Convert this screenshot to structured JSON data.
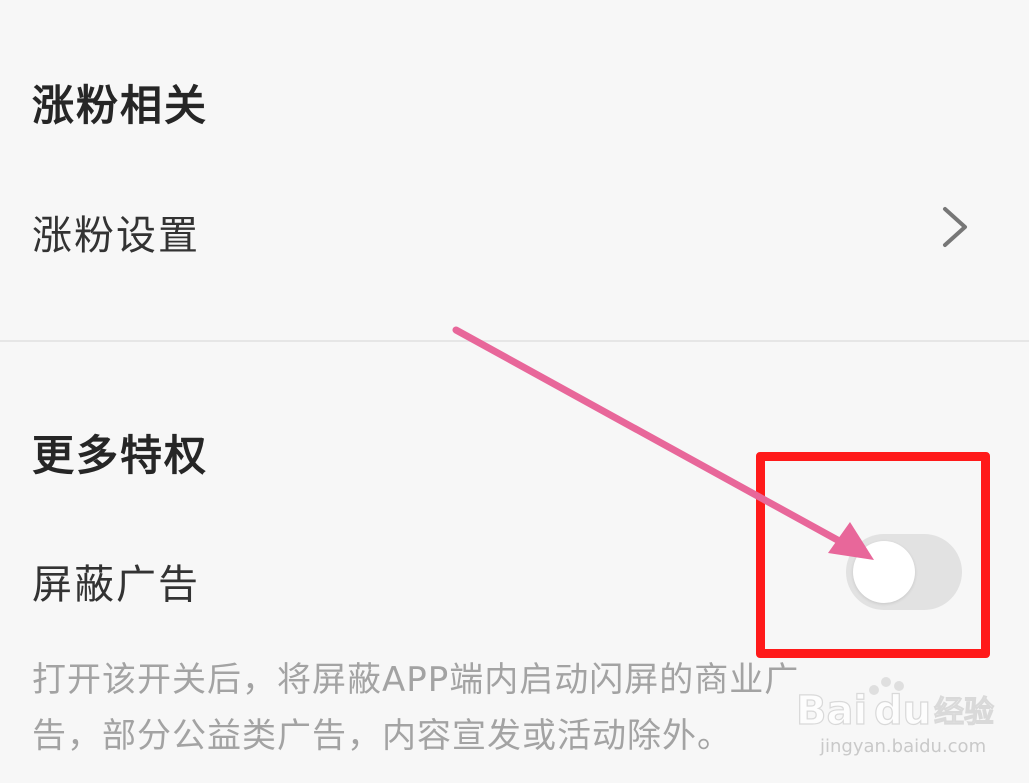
{
  "sections": {
    "fans": {
      "title": "涨粉相关",
      "settings_label": "涨粉设置"
    },
    "privileges": {
      "title": "更多特权",
      "block_ads_label": "屏蔽广告",
      "block_ads_enabled": false,
      "description_line1": "打开该开关后，将屏蔽APP端内启动闪屏的商业广",
      "description_line2": "告，部分公益类广告，内容宣发或活动除外。"
    }
  },
  "annotations": {
    "highlight_color": "#ff1a1a",
    "arrow_color": "#e8679a"
  },
  "watermark": {
    "brand": "Bai du 经验",
    "url": "jingyan.baidu.com"
  },
  "icons": {
    "settings_chevron": "chevron-right-icon"
  }
}
